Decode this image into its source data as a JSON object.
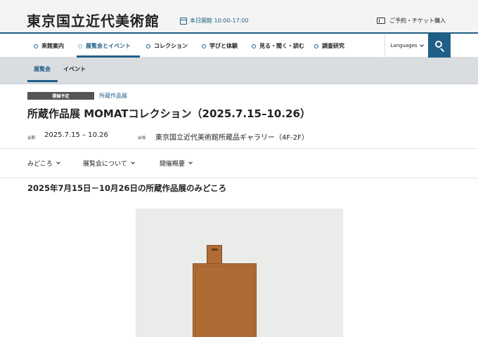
{
  "header": {
    "logo": "東京国立近代美術館",
    "hours": "本日開館 10:00-17:00",
    "ticket": "ご予約・チケット購入"
  },
  "nav": {
    "items": [
      {
        "label": "来館案内"
      },
      {
        "label": "展覧会とイベント"
      },
      {
        "label": "コレクション"
      },
      {
        "label": "学びと体験"
      },
      {
        "label": "見る・聞く・読む"
      },
      {
        "label": "調査研究"
      }
    ],
    "language": "Languages"
  },
  "subnav": {
    "items": [
      {
        "label": "展覧会"
      },
      {
        "label": "イベント"
      }
    ]
  },
  "exhibition": {
    "status": "開催予定",
    "category": "所蔵作品展",
    "title": "所蔵作品展 MOMATコレクション（2025.7.15–10.26）",
    "period_label": "会期",
    "period": "2025.7.15 – 10.26",
    "venue_label": "会場",
    "venue": "東京国立近代美術館所蔵品ギャラリー（4F-2F）"
  },
  "tabs": [
    {
      "label": "みどころ"
    },
    {
      "label": "展覧会について"
    },
    {
      "label": "開催概要"
    }
  ],
  "section": {
    "title": "2025年7月15日－10月26日の所蔵作品展のみどころ"
  },
  "colors": {
    "accent": "#1f5e86",
    "subnav_bg": "#d9dde0",
    "badge_bg": "#555555",
    "artwork": "#b06b34"
  }
}
